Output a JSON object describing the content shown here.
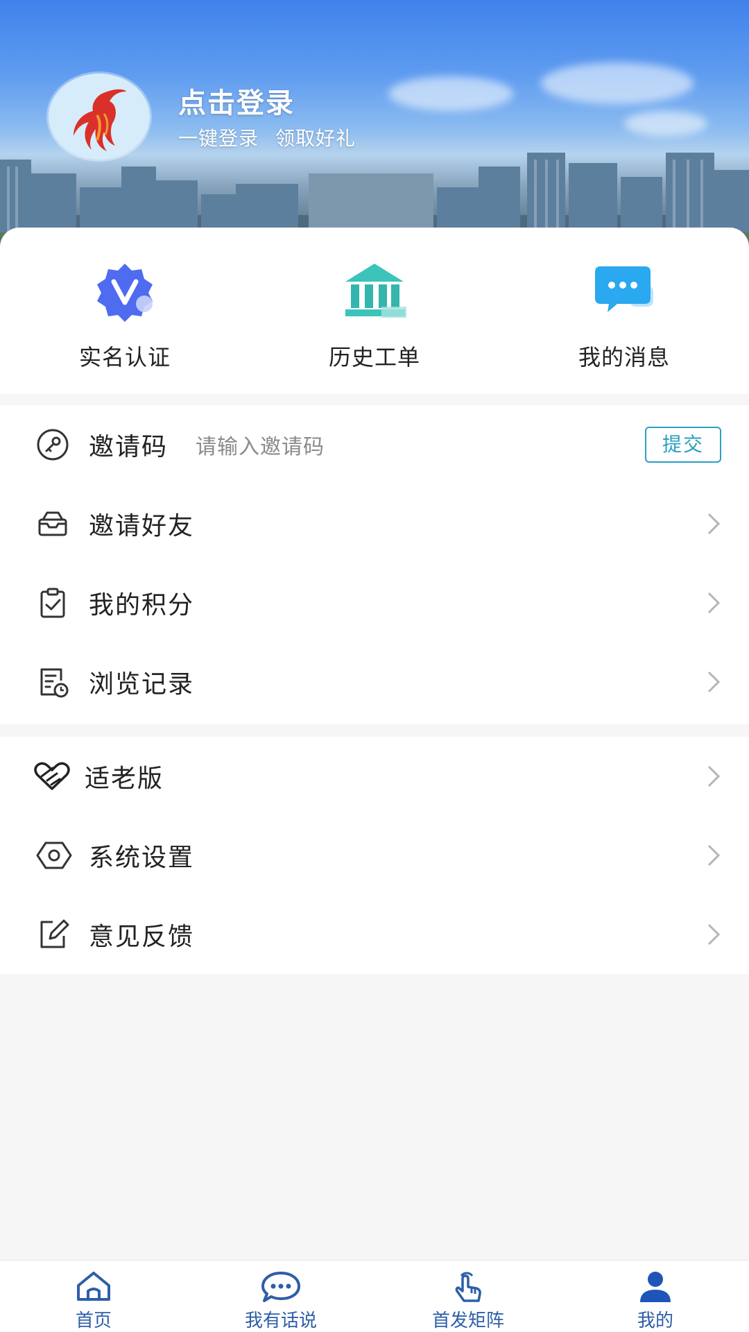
{
  "header": {
    "login_title": "点击登录",
    "login_sub_1": "一键登录",
    "login_sub_2": "领取好礼"
  },
  "quick_actions": [
    {
      "label": "实名认证",
      "icon": "verified-badge-icon"
    },
    {
      "label": "历史工单",
      "icon": "bank-building-icon"
    },
    {
      "label": "我的消息",
      "icon": "chat-bubble-icon"
    }
  ],
  "invite": {
    "label": "邀请码",
    "placeholder": "请输入邀请码",
    "submit_label": "提交"
  },
  "menu_group_1": [
    {
      "label": "邀请好友",
      "icon": "inbox-icon"
    },
    {
      "label": "我的积分",
      "icon": "clipboard-check-icon"
    },
    {
      "label": "浏览记录",
      "icon": "history-doc-icon"
    }
  ],
  "menu_group_2": [
    {
      "label": "适老版",
      "icon": "handshake-heart-icon"
    },
    {
      "label": "系统设置",
      "icon": "hex-settings-icon"
    },
    {
      "label": "意见反馈",
      "icon": "edit-icon"
    }
  ],
  "tabs": [
    {
      "label": "首页",
      "icon": "home-icon"
    },
    {
      "label": "我有话说",
      "icon": "chat-icon"
    },
    {
      "label": "首发矩阵",
      "icon": "tap-hand-icon"
    },
    {
      "label": "我的",
      "icon": "person-icon"
    }
  ],
  "colors": {
    "accent": "#2b9fc4",
    "tab_text": "#2e5ea8",
    "header_blue": "#3f82ec"
  }
}
